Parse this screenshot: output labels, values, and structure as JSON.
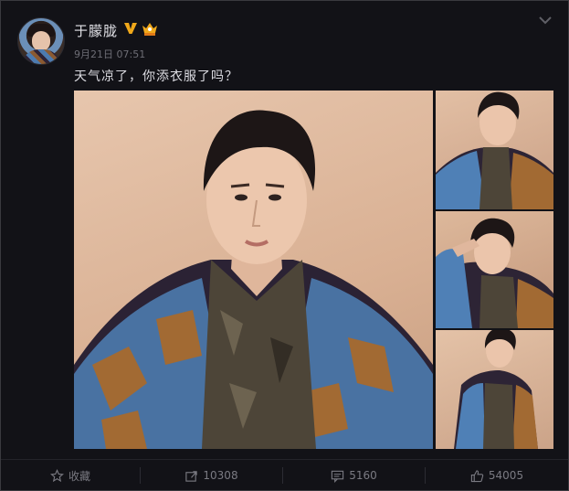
{
  "post": {
    "username": "于朦胧",
    "timestamp": "9月21日 07:51",
    "text": "天气凉了，你添衣服了吗？",
    "badges": [
      "vip-v-icon",
      "crown-icon"
    ],
    "images": [
      {
        "name": "main-photo"
      },
      {
        "name": "side-photo-1"
      },
      {
        "name": "side-photo-2"
      },
      {
        "name": "side-photo-3"
      }
    ]
  },
  "actions": {
    "favorite_label": "收藏",
    "repost_count": "10308",
    "comment_count": "5160",
    "like_count": "54005"
  },
  "colors": {
    "background": "#121217",
    "vip_gold": "#f0a81a",
    "text_primary": "#dcdce2",
    "text_muted": "#7a7a82"
  }
}
